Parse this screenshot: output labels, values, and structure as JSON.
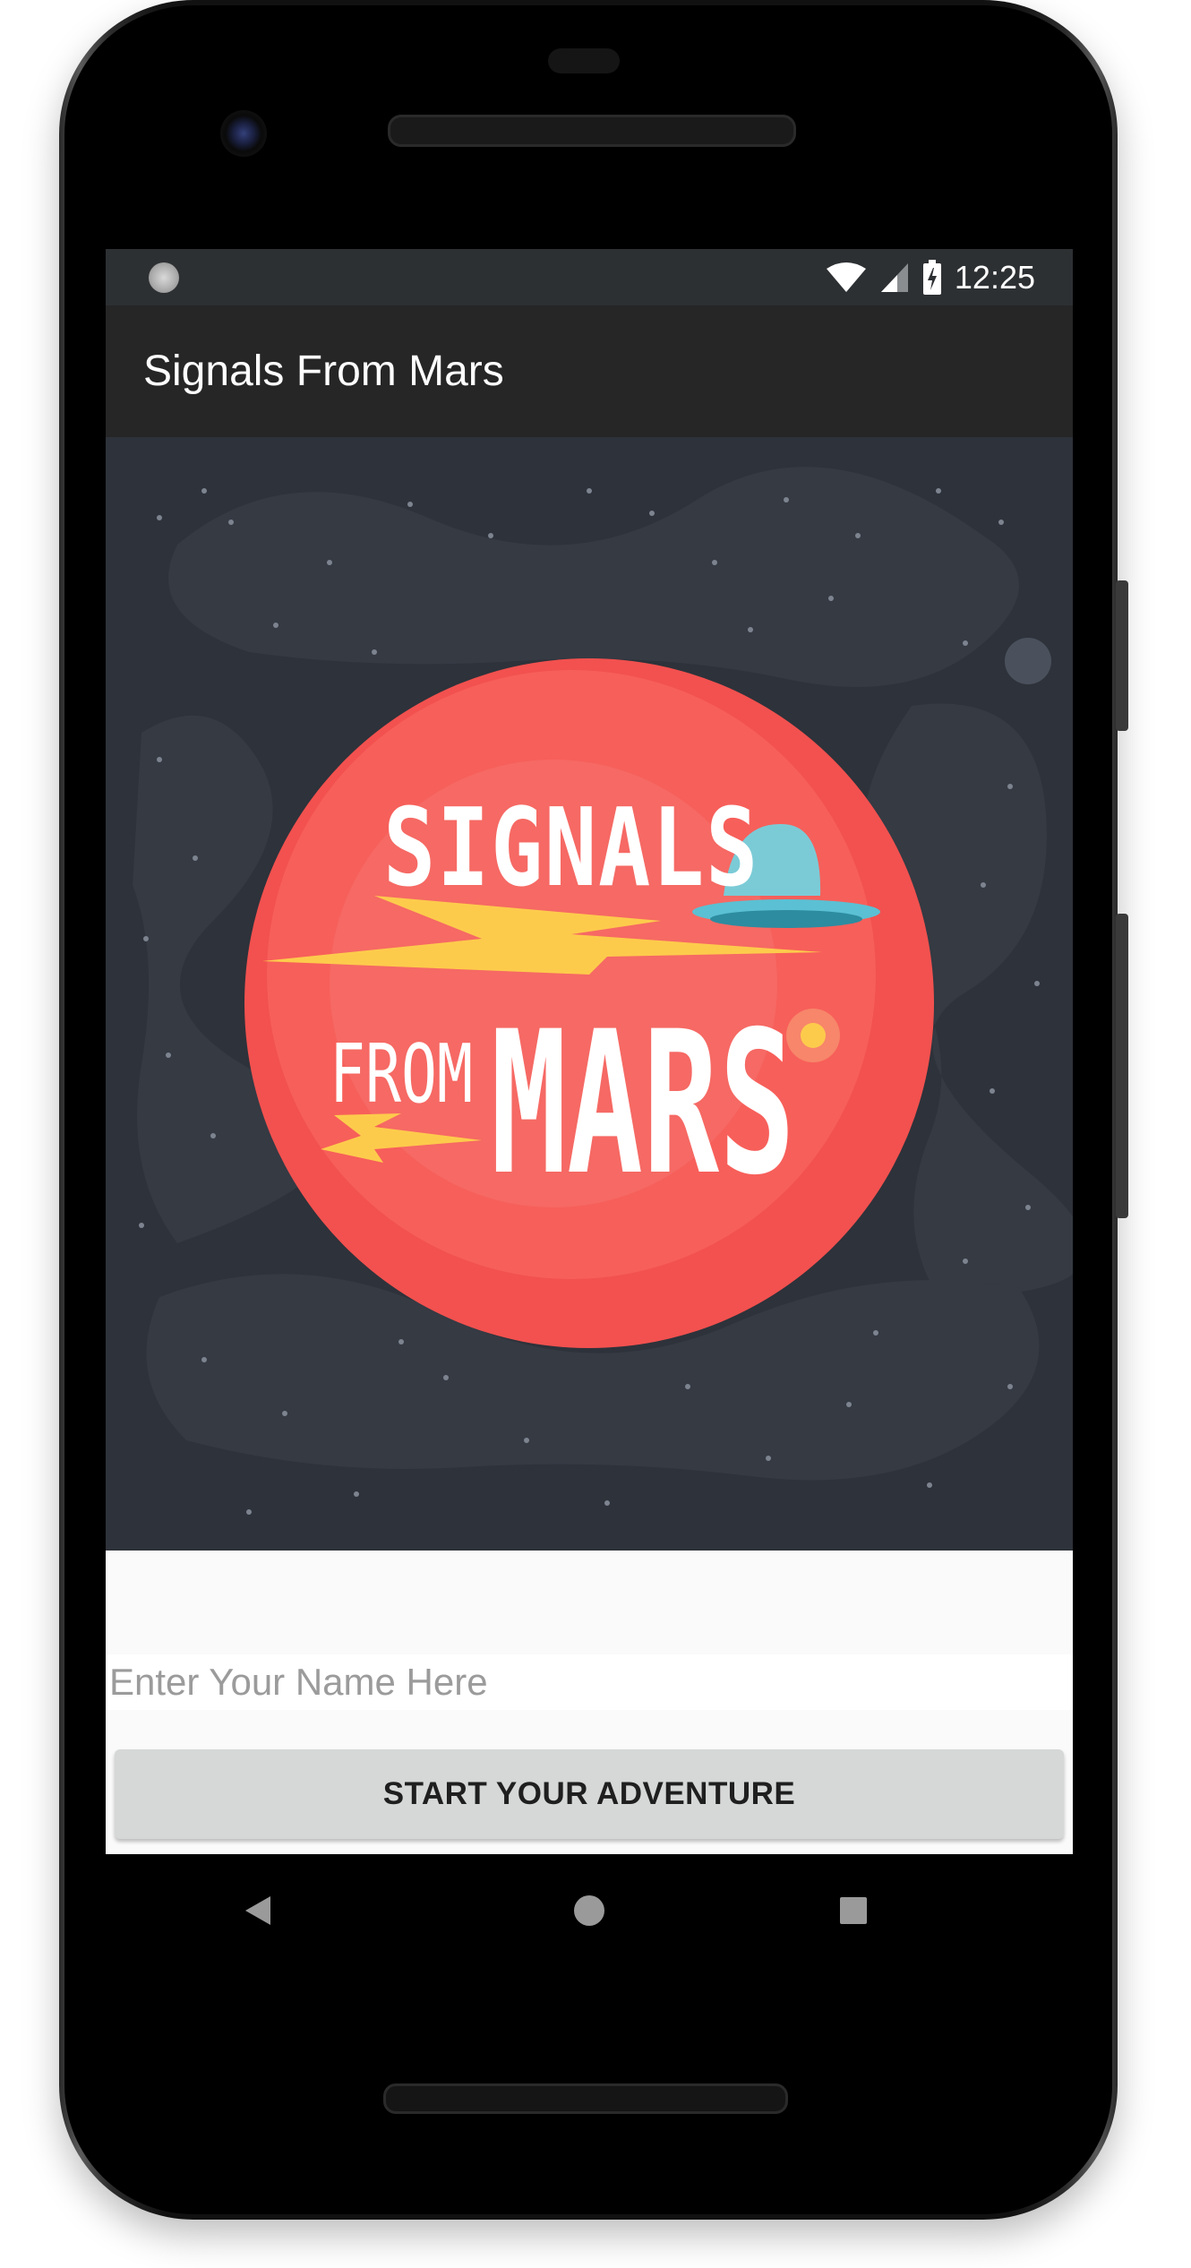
{
  "status_bar": {
    "time": "12:25",
    "left_icon": "sync-icon",
    "icons": [
      "wifi-icon",
      "cell-signal-icon",
      "battery-charging-icon"
    ]
  },
  "app_bar": {
    "title": "Signals From Mars"
  },
  "hero": {
    "logo_line1": "SIGNALS",
    "logo_line2a": "FROM",
    "logo_line2b": "MARS",
    "colors": {
      "planet": "#f2514f",
      "sky": "#2e323a",
      "bolt": "#fdcb4c",
      "ufo": "#5bc0d3"
    }
  },
  "form": {
    "name_placeholder": "Enter Your Name Here",
    "name_value": "",
    "start_button_label": "START YOUR ADVENTURE"
  },
  "nav_bar": {
    "buttons": [
      "back-icon",
      "home-icon",
      "recents-icon"
    ]
  }
}
